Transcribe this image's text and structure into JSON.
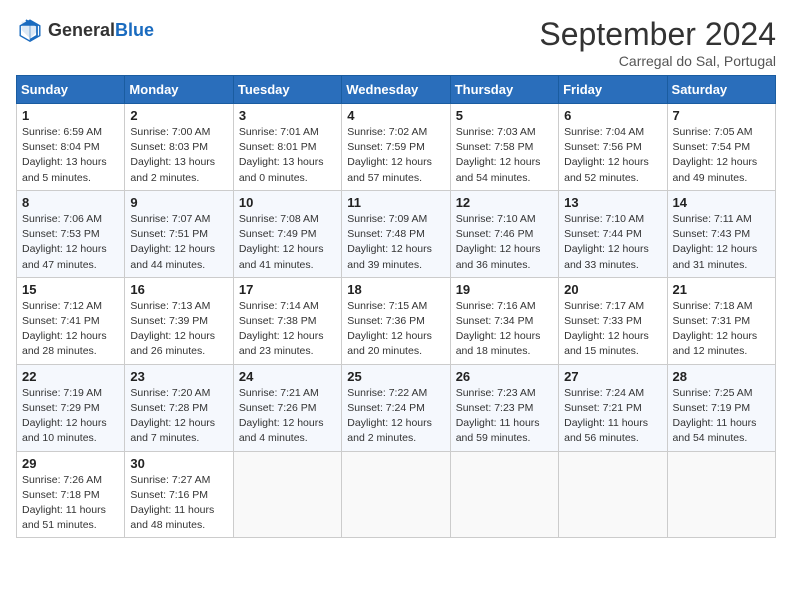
{
  "header": {
    "logo_general": "General",
    "logo_blue": "Blue",
    "title": "September 2024",
    "subtitle": "Carregal do Sal, Portugal"
  },
  "weekdays": [
    "Sunday",
    "Monday",
    "Tuesday",
    "Wednesday",
    "Thursday",
    "Friday",
    "Saturday"
  ],
  "weeks": [
    [
      {
        "day": "1",
        "sunrise": "Sunrise: 6:59 AM",
        "sunset": "Sunset: 8:04 PM",
        "daylight": "Daylight: 13 hours and 5 minutes."
      },
      {
        "day": "2",
        "sunrise": "Sunrise: 7:00 AM",
        "sunset": "Sunset: 8:03 PM",
        "daylight": "Daylight: 13 hours and 2 minutes."
      },
      {
        "day": "3",
        "sunrise": "Sunrise: 7:01 AM",
        "sunset": "Sunset: 8:01 PM",
        "daylight": "Daylight: 13 hours and 0 minutes."
      },
      {
        "day": "4",
        "sunrise": "Sunrise: 7:02 AM",
        "sunset": "Sunset: 7:59 PM",
        "daylight": "Daylight: 12 hours and 57 minutes."
      },
      {
        "day": "5",
        "sunrise": "Sunrise: 7:03 AM",
        "sunset": "Sunset: 7:58 PM",
        "daylight": "Daylight: 12 hours and 54 minutes."
      },
      {
        "day": "6",
        "sunrise": "Sunrise: 7:04 AM",
        "sunset": "Sunset: 7:56 PM",
        "daylight": "Daylight: 12 hours and 52 minutes."
      },
      {
        "day": "7",
        "sunrise": "Sunrise: 7:05 AM",
        "sunset": "Sunset: 7:54 PM",
        "daylight": "Daylight: 12 hours and 49 minutes."
      }
    ],
    [
      {
        "day": "8",
        "sunrise": "Sunrise: 7:06 AM",
        "sunset": "Sunset: 7:53 PM",
        "daylight": "Daylight: 12 hours and 47 minutes."
      },
      {
        "day": "9",
        "sunrise": "Sunrise: 7:07 AM",
        "sunset": "Sunset: 7:51 PM",
        "daylight": "Daylight: 12 hours and 44 minutes."
      },
      {
        "day": "10",
        "sunrise": "Sunrise: 7:08 AM",
        "sunset": "Sunset: 7:49 PM",
        "daylight": "Daylight: 12 hours and 41 minutes."
      },
      {
        "day": "11",
        "sunrise": "Sunrise: 7:09 AM",
        "sunset": "Sunset: 7:48 PM",
        "daylight": "Daylight: 12 hours and 39 minutes."
      },
      {
        "day": "12",
        "sunrise": "Sunrise: 7:10 AM",
        "sunset": "Sunset: 7:46 PM",
        "daylight": "Daylight: 12 hours and 36 minutes."
      },
      {
        "day": "13",
        "sunrise": "Sunrise: 7:10 AM",
        "sunset": "Sunset: 7:44 PM",
        "daylight": "Daylight: 12 hours and 33 minutes."
      },
      {
        "day": "14",
        "sunrise": "Sunrise: 7:11 AM",
        "sunset": "Sunset: 7:43 PM",
        "daylight": "Daylight: 12 hours and 31 minutes."
      }
    ],
    [
      {
        "day": "15",
        "sunrise": "Sunrise: 7:12 AM",
        "sunset": "Sunset: 7:41 PM",
        "daylight": "Daylight: 12 hours and 28 minutes."
      },
      {
        "day": "16",
        "sunrise": "Sunrise: 7:13 AM",
        "sunset": "Sunset: 7:39 PM",
        "daylight": "Daylight: 12 hours and 26 minutes."
      },
      {
        "day": "17",
        "sunrise": "Sunrise: 7:14 AM",
        "sunset": "Sunset: 7:38 PM",
        "daylight": "Daylight: 12 hours and 23 minutes."
      },
      {
        "day": "18",
        "sunrise": "Sunrise: 7:15 AM",
        "sunset": "Sunset: 7:36 PM",
        "daylight": "Daylight: 12 hours and 20 minutes."
      },
      {
        "day": "19",
        "sunrise": "Sunrise: 7:16 AM",
        "sunset": "Sunset: 7:34 PM",
        "daylight": "Daylight: 12 hours and 18 minutes."
      },
      {
        "day": "20",
        "sunrise": "Sunrise: 7:17 AM",
        "sunset": "Sunset: 7:33 PM",
        "daylight": "Daylight: 12 hours and 15 minutes."
      },
      {
        "day": "21",
        "sunrise": "Sunrise: 7:18 AM",
        "sunset": "Sunset: 7:31 PM",
        "daylight": "Daylight: 12 hours and 12 minutes."
      }
    ],
    [
      {
        "day": "22",
        "sunrise": "Sunrise: 7:19 AM",
        "sunset": "Sunset: 7:29 PM",
        "daylight": "Daylight: 12 hours and 10 minutes."
      },
      {
        "day": "23",
        "sunrise": "Sunrise: 7:20 AM",
        "sunset": "Sunset: 7:28 PM",
        "daylight": "Daylight: 12 hours and 7 minutes."
      },
      {
        "day": "24",
        "sunrise": "Sunrise: 7:21 AM",
        "sunset": "Sunset: 7:26 PM",
        "daylight": "Daylight: 12 hours and 4 minutes."
      },
      {
        "day": "25",
        "sunrise": "Sunrise: 7:22 AM",
        "sunset": "Sunset: 7:24 PM",
        "daylight": "Daylight: 12 hours and 2 minutes."
      },
      {
        "day": "26",
        "sunrise": "Sunrise: 7:23 AM",
        "sunset": "Sunset: 7:23 PM",
        "daylight": "Daylight: 11 hours and 59 minutes."
      },
      {
        "day": "27",
        "sunrise": "Sunrise: 7:24 AM",
        "sunset": "Sunset: 7:21 PM",
        "daylight": "Daylight: 11 hours and 56 minutes."
      },
      {
        "day": "28",
        "sunrise": "Sunrise: 7:25 AM",
        "sunset": "Sunset: 7:19 PM",
        "daylight": "Daylight: 11 hours and 54 minutes."
      }
    ],
    [
      {
        "day": "29",
        "sunrise": "Sunrise: 7:26 AM",
        "sunset": "Sunset: 7:18 PM",
        "daylight": "Daylight: 11 hours and 51 minutes."
      },
      {
        "day": "30",
        "sunrise": "Sunrise: 7:27 AM",
        "sunset": "Sunset: 7:16 PM",
        "daylight": "Daylight: 11 hours and 48 minutes."
      },
      null,
      null,
      null,
      null,
      null
    ]
  ]
}
